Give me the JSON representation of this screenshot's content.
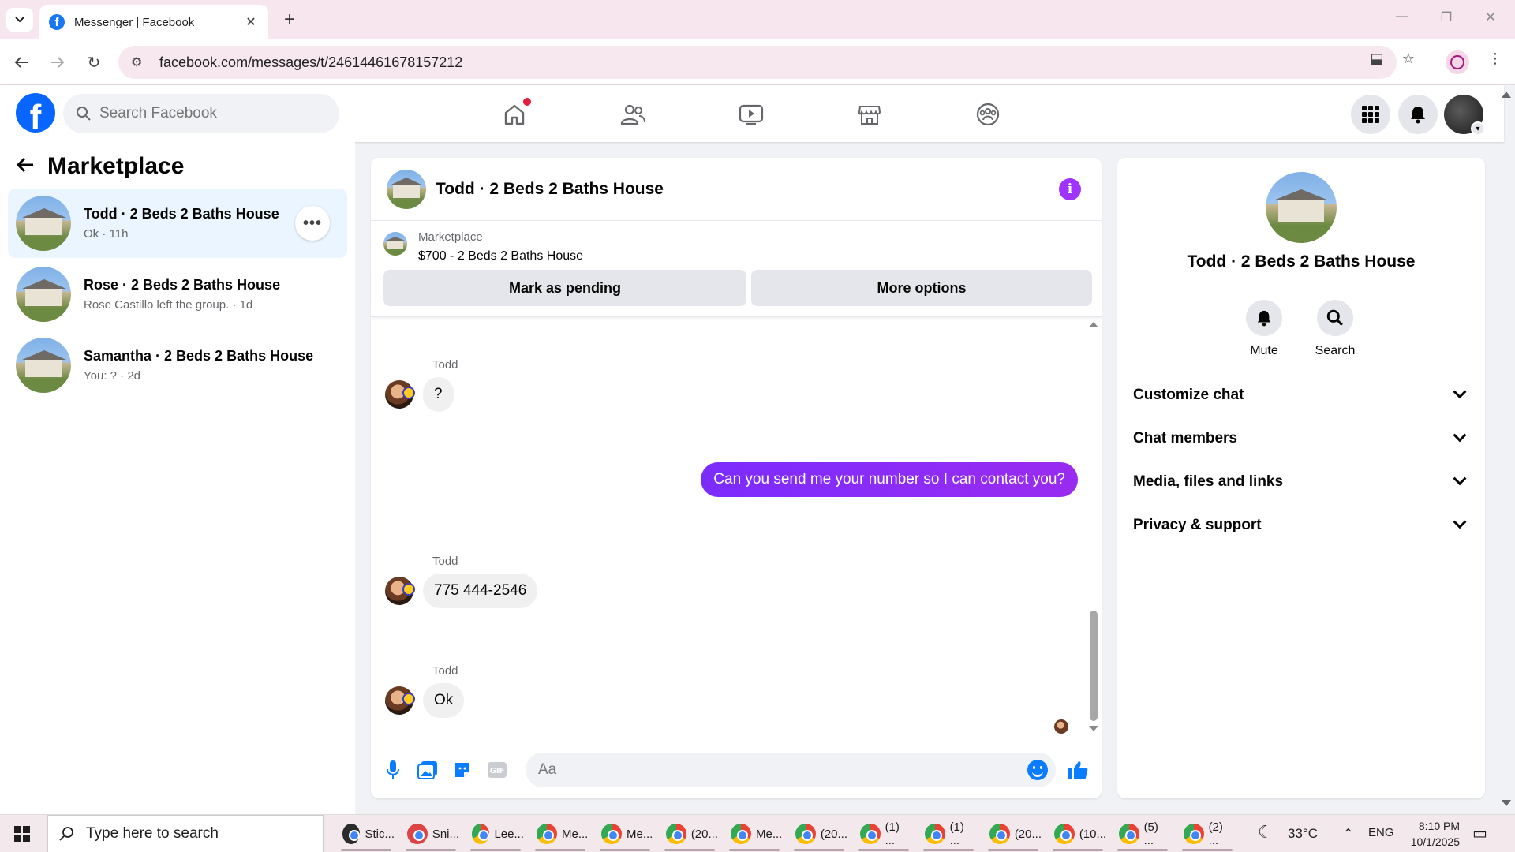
{
  "browser": {
    "tab_title": "Messenger | Facebook",
    "url": "facebook.com/messages/t/24614461678157212"
  },
  "fb": {
    "logo_letter": "f",
    "search_placeholder": "Search Facebook"
  },
  "left": {
    "title": "Marketplace",
    "threads": [
      {
        "name": "Todd · 2 Beds 2 Baths House",
        "sub": "Ok · 11h",
        "active": true
      },
      {
        "name": "Rose · 2 Beds 2 Baths House",
        "sub": "Rose Castillo left the group. · 1d",
        "active": false
      },
      {
        "name": "Samantha · 2 Beds 2 Baths House",
        "sub": "You: ? · 2d",
        "active": false
      }
    ]
  },
  "chat": {
    "title": "Todd · 2 Beds 2 Baths House",
    "marketplace_label": "Marketplace",
    "listing": "$700 - 2 Beds 2 Baths House",
    "btn_pending": "Mark as pending",
    "btn_more": "More options",
    "messages": [
      {
        "from": "Todd",
        "text": "?",
        "dir": "in"
      },
      {
        "from": "",
        "text": "Can you send me your number so I can contact you?",
        "dir": "out"
      },
      {
        "from": "Todd",
        "text": "775 444-2546",
        "dir": "in"
      },
      {
        "from": "Todd",
        "text": "Ok",
        "dir": "in"
      }
    ],
    "composer_placeholder": "Aa"
  },
  "info": {
    "name": "Todd · 2 Beds 2 Baths House",
    "actions": [
      "Mute",
      "Search"
    ],
    "sections": [
      "Customize chat",
      "Chat members",
      "Media, files and links",
      "Privacy & support"
    ]
  },
  "taskbar": {
    "search_placeholder": "Type here to search",
    "apps": [
      "Stic...",
      "Sni...",
      "Lee...",
      "Me...",
      "Me...",
      "(20...",
      "Me...",
      "(20...",
      "(1) ...",
      "(1) ...",
      "(20...",
      "(10...",
      "(5) ...",
      "(2) ..."
    ],
    "weather": "33°C",
    "lang": "ENG",
    "time": "8:10 PM",
    "date": "10/1/2025"
  },
  "colors": {
    "fb_blue": "#0866ff",
    "outgoing_bubble": "#8a2cff",
    "active_thread": "#ebf5ff"
  }
}
